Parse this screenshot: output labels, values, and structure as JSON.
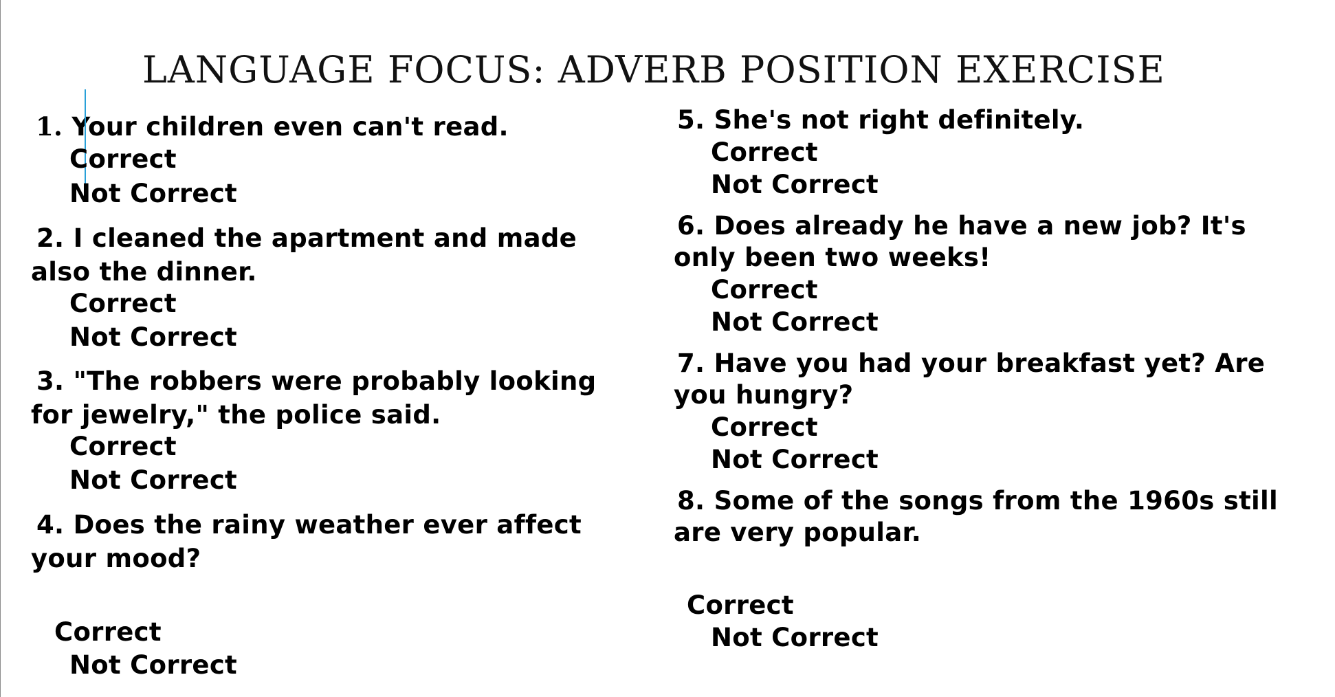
{
  "title": "LANGUAGE FOCUS: ADVERB POSITION EXERCISE",
  "questions": [
    {
      "num": "1.",
      "line1": "Your children even can't read.",
      "line2": "",
      "correct": "Correct",
      "not_correct": "Not Correct"
    },
    {
      "num": "2.",
      "line1": "I cleaned the apartment and made",
      "line2": "also the dinner.",
      "correct": "Correct",
      "not_correct": "Not Correct"
    },
    {
      "num": "3.",
      "line1": "\"The robbers were probably looking",
      "line2": "for jewelry,\" the police said.",
      "correct": "Correct",
      "not_correct": "Not Correct"
    },
    {
      "num": "4.",
      "line1": "Does the rainy weather ever affect",
      "line2": "your mood?",
      "correct": "Correct",
      "not_correct": "Not Correct"
    },
    {
      "num": "5.",
      "line1": "She's not right definitely.",
      "line2": "",
      "correct": "Correct",
      "not_correct": "Not Correct"
    },
    {
      "num": "6.",
      "line1": "Does already he have a new job? It's",
      "line2": "only been two weeks!",
      "correct": "Correct",
      "not_correct": "Not Correct"
    },
    {
      "num": "7.",
      "line1": "Have you had your breakfast yet? Are",
      "line2": "you hungry?",
      "correct": "Correct",
      "not_correct": "Not Correct"
    },
    {
      "num": "8.",
      "line1": "Some of the songs from the 1960s still",
      "line2": "are very popular.",
      "correct": "Correct",
      "not_correct": "Not Correct"
    }
  ]
}
